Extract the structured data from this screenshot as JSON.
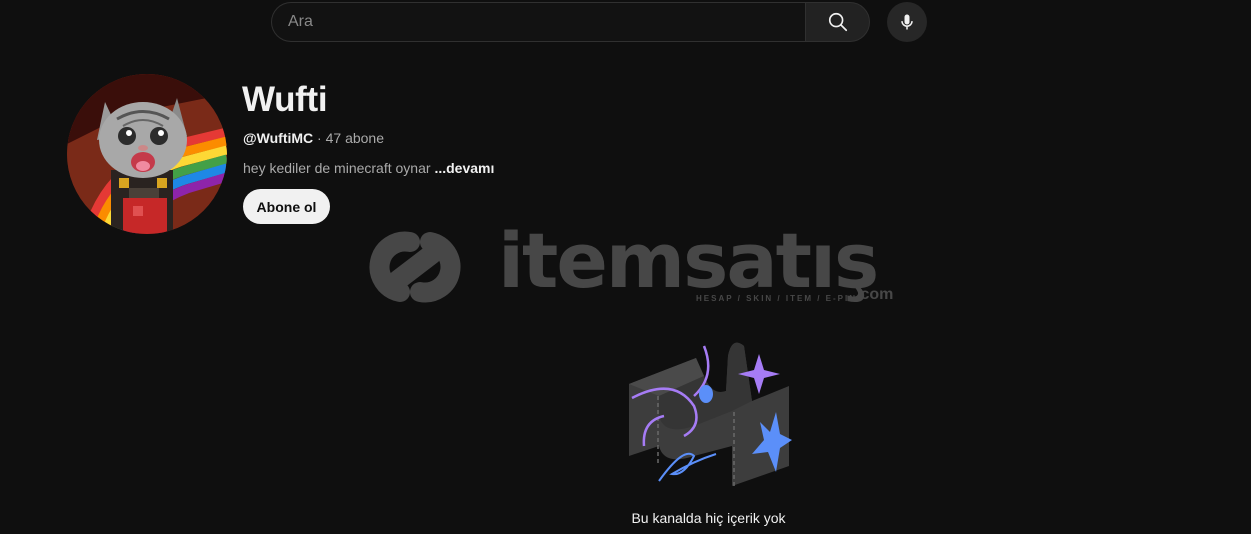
{
  "search": {
    "placeholder": "Ara"
  },
  "channel": {
    "name": "Wufti",
    "handle": "@WuftiMC",
    "separator": " · ",
    "subscribers": "47 abone",
    "description": "hey kediler de minecraft oynar",
    "more_label": "...devamı",
    "subscribe_label": "Abone ol"
  },
  "watermark": {
    "brand": "itemsatış",
    "tagline": "HESAP / SKIN / ITEM / E-PIN",
    "domain": ".com"
  },
  "empty_state": {
    "message": "Bu kanalda hiç içerik yok"
  },
  "icons": [
    "search-icon",
    "mic-icon"
  ],
  "colors": {
    "background": "#0f0f0f",
    "text": "#f1f1f1",
    "muted": "#aaaaaa",
    "accent_purple": "#a67cf5",
    "accent_blue": "#5b8ff9"
  }
}
